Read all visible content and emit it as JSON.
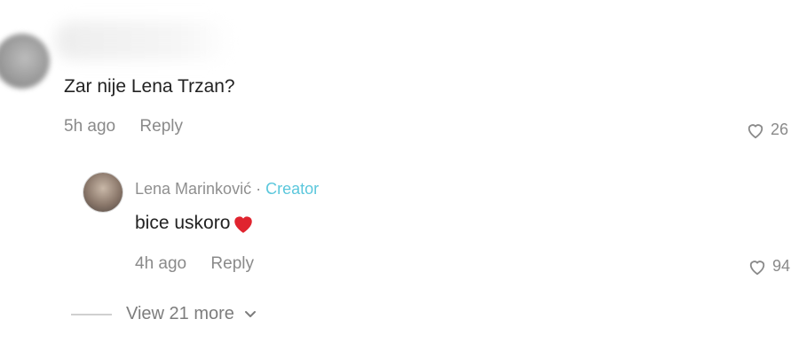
{
  "comment": {
    "text": "Zar nije Lena Trzan?",
    "time": "5h ago",
    "reply_label": "Reply",
    "likes": "26"
  },
  "reply": {
    "author": "Lena Marinković",
    "separator": "·",
    "badge": "Creator",
    "text": "bice uskoro",
    "time": "4h ago",
    "reply_label": "Reply",
    "likes": "94"
  },
  "view_more": {
    "label": "View 21 more"
  },
  "colors": {
    "creator_badge": "#5bc7dc",
    "heart_emoji": "#e0242f"
  },
  "icons": [
    "heart-outline-icon",
    "heart-emoji-icon",
    "chevron-down-icon"
  ]
}
